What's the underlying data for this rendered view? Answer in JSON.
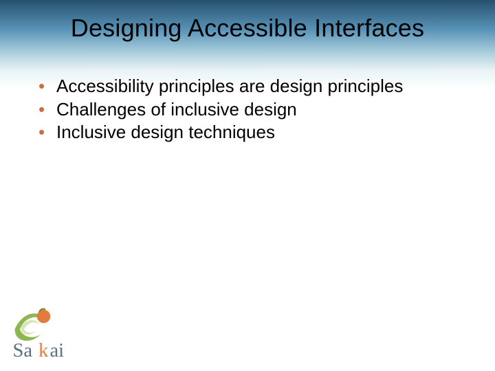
{
  "title": "Designing Accessible Interfaces",
  "bullets": [
    "Accessibility principles are design principles",
    "Challenges of inclusive design",
    "Inclusive design techniques"
  ],
  "logo": {
    "word_prefix": "Sa",
    "word_suffix": "ai",
    "letter_k": "k"
  }
}
